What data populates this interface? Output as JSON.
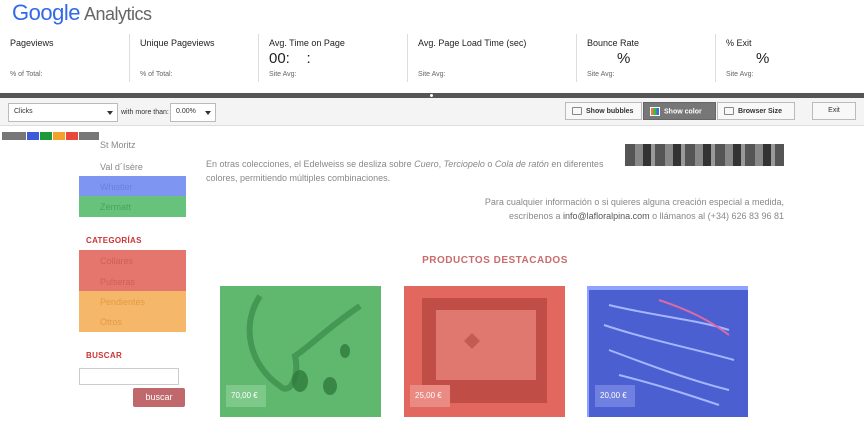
{
  "logo": {
    "brand": "Google",
    "product": "Analytics"
  },
  "metrics": [
    {
      "label": "Pageviews",
      "value": "",
      "sub": "% of Total:"
    },
    {
      "label": "Unique Pageviews",
      "value": "",
      "sub": "% of Total:"
    },
    {
      "label": "Avg. Time on Page",
      "value": "00:    :",
      "sub": "Site Avg:"
    },
    {
      "label": "Avg. Page Load Time (sec)",
      "value": "",
      "sub": "Site Avg:"
    },
    {
      "label": "Bounce Rate",
      "value": "%",
      "sub": "Site Avg:"
    },
    {
      "label": "% Exit",
      "value": "%",
      "sub": "Site Avg:"
    }
  ],
  "toolbar": {
    "metric_select": "Clicks",
    "with_more_than_label": "with more than:",
    "threshold_select": "0.00%",
    "show_bubbles": "Show bubbles",
    "show_color": "Show color",
    "browser_size": "Browser Size",
    "exit": "Exit"
  },
  "colors": {
    "green": "#3fae4f",
    "red": "#e8473a",
    "blue": "#3b5bdb",
    "orange": "#f3a12b",
    "swatch_gray": "#777777"
  },
  "sidebar": {
    "locations": [
      "St Moritz",
      "Val d´Isère",
      "Whistler",
      "Zermatt"
    ],
    "categories_title": "CATEGORÍAS",
    "categories": [
      "Collares",
      "Pulseras",
      "Pendientes",
      "Otros"
    ],
    "search_title": "BUSCAR",
    "search_button": "buscar"
  },
  "content": {
    "para1_pre": "En otras colecciones, el Edelweiss se desliza sobre ",
    "para1_i1": "Cuero",
    "para1_c1": ", ",
    "para1_i2": "Terciopelo",
    "para1_c2": " o ",
    "para1_i3": "Cola de ratón",
    "para1_post": " en diferentes",
    "para1_line2": "colores, permitiendo múltiples combinaciones.",
    "contact_line1": "Para cualquier información o si quieres alguna creación especial a medida,",
    "contact_line2_pre": "escríbenos a ",
    "contact_email": "info@lafloralpina.com",
    "contact_line2_post": " o llámanos al  (+34) 626 83 96 81",
    "featured_title": "PRODUCTOS DESTACADOS",
    "products": [
      {
        "price": "70,00 €"
      },
      {
        "price": "25,00 €"
      },
      {
        "price": "20,00 €"
      }
    ]
  }
}
